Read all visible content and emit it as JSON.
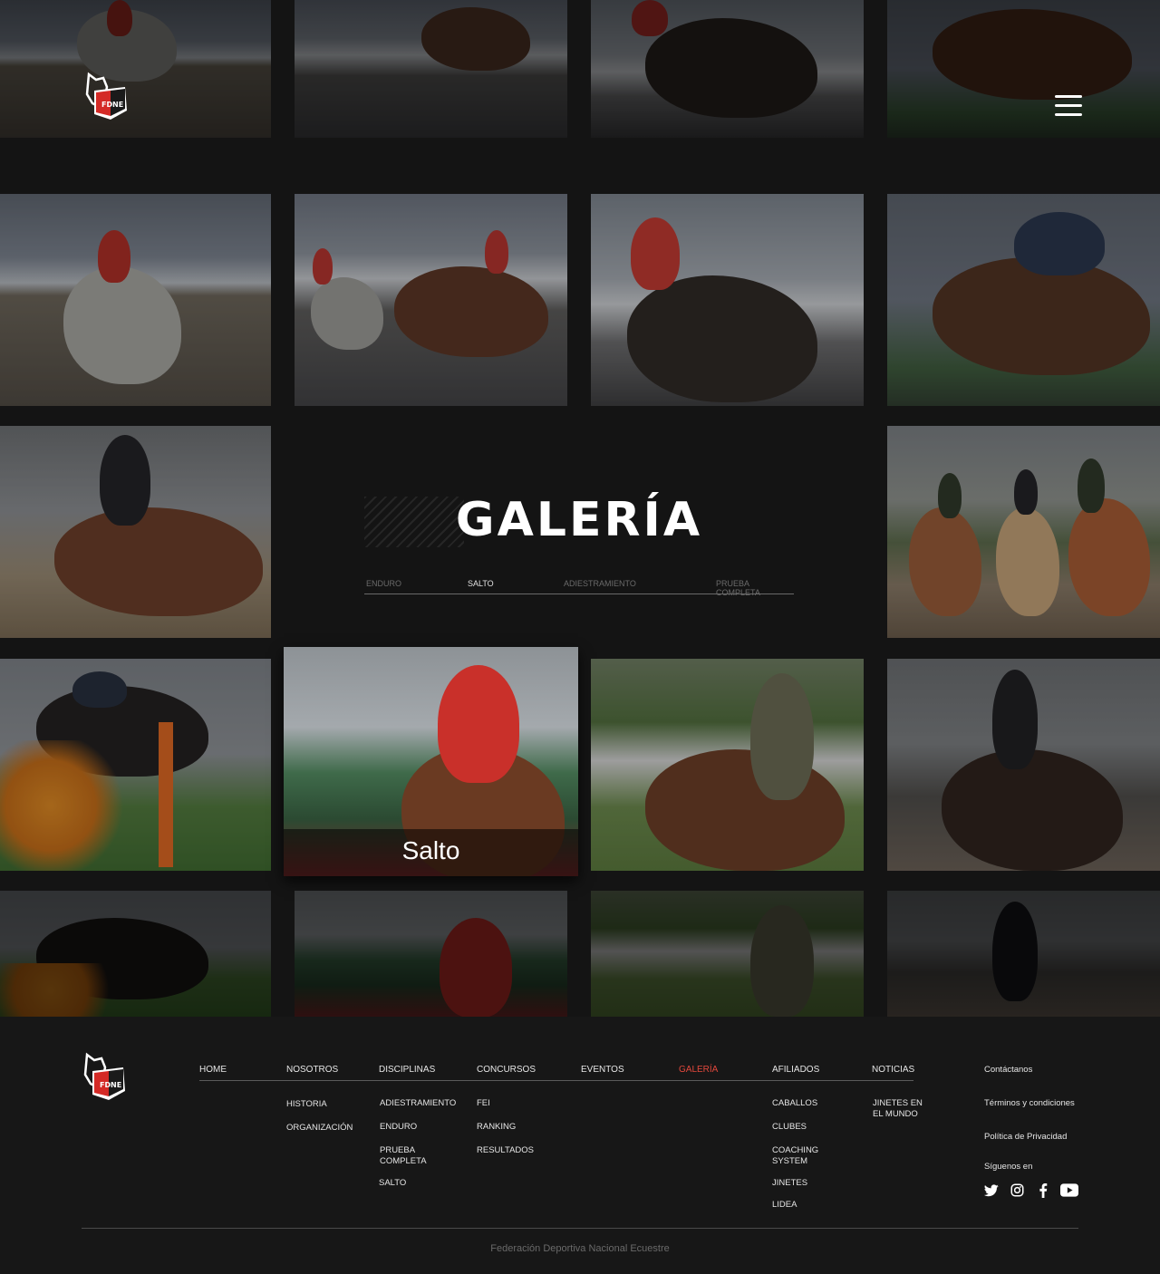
{
  "header": {
    "logo_text": "FDNE",
    "menu_icon": "hamburger-icon"
  },
  "gallery": {
    "title": "GALERÍA",
    "filters": [
      {
        "label": "ENDURO",
        "active": false
      },
      {
        "label": "SALTO",
        "active": true
      },
      {
        "label": "ADIESTRAMIENTO",
        "active": false
      },
      {
        "label": "PRUEBA COMPLETA",
        "active": false
      }
    ],
    "hover_caption": "Salto"
  },
  "footer": {
    "logo_text": "FDNE",
    "nav": [
      {
        "label": "HOME",
        "active": false
      },
      {
        "label": "NOSOTROS",
        "active": false
      },
      {
        "label": "DISCIPLINAS",
        "active": false
      },
      {
        "label": "CONCURSOS",
        "active": false
      },
      {
        "label": "EVENTOS",
        "active": false
      },
      {
        "label": "GALERÍA",
        "active": true
      },
      {
        "label": "AFILIADOS",
        "active": false
      },
      {
        "label": "NOTICIAS",
        "active": false
      }
    ],
    "nosotros_sub": [
      "HISTORIA",
      "ORGANIZACIÓN"
    ],
    "disciplinas_sub": [
      "ADIESTRAMIENTO",
      "ENDURO",
      "PRUEBA COMPLETA",
      "SALTO"
    ],
    "concursos_sub": [
      "FEI",
      "RANKING",
      "RESULTADOS"
    ],
    "afiliados_sub": [
      "CABALLOS",
      "CLUBES",
      "COACHING SYSTEM",
      "JINETES",
      "LIDEA"
    ],
    "noticias_sub": [
      "JINETES EN EL MUNDO"
    ],
    "side_links": [
      "Contáctanos",
      "Términos y condiciones",
      "Política de Privacidad"
    ],
    "follow_label": "Síguenos en",
    "socials": [
      "twitter-icon",
      "instagram-icon",
      "facebook-icon",
      "youtube-icon"
    ],
    "copyright": "Federación Deportiva Nacional Ecuestre"
  },
  "colors": {
    "background": "#141414",
    "footer_bg": "#171717",
    "accent_red": "#e2473c",
    "muted_text": "#6a6a6a"
  }
}
